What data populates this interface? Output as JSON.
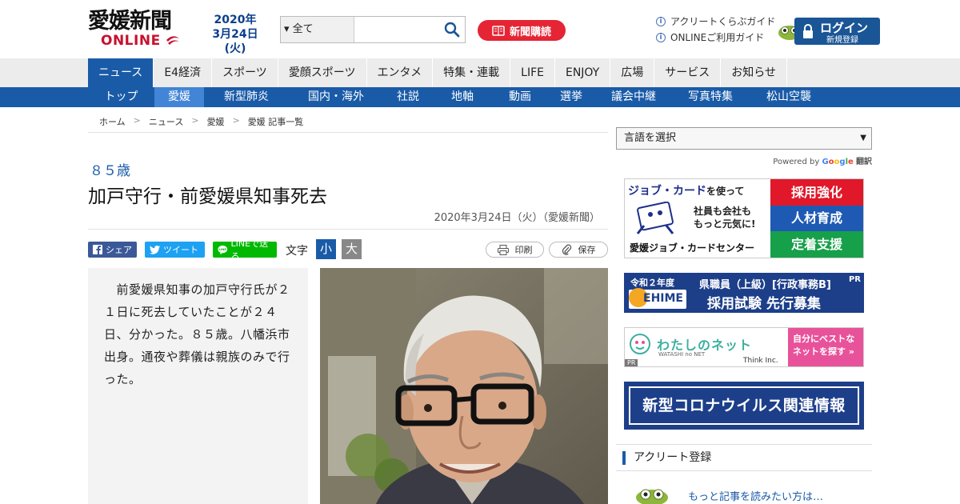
{
  "header": {
    "logo_line1": "愛媛新聞",
    "logo_line2": "ONLINE",
    "date_year": "2020年",
    "date_day": "3月24日(火)",
    "search_scope": "全て",
    "search_placeholder": "",
    "subscribe_label": "新聞購読",
    "links": [
      "アクリートくらぶガイド",
      "ONLINEご利用ガイド"
    ],
    "login_label": "ログイン",
    "register_label": "新規登録",
    "colors": {
      "brand_blue": "#1a5ba8",
      "brand_red": "#e52434"
    }
  },
  "main_nav": [
    "ニュース",
    "E4経済",
    "スポーツ",
    "愛顔スポーツ",
    "エンタメ",
    "特集・連載",
    "LIFE",
    "ENJOY",
    "広場",
    "サービス",
    "お知らせ"
  ],
  "sub_nav": [
    "トップ",
    "愛媛",
    "新型肺炎",
    "国内・海外",
    "社説",
    "地軸",
    "動画",
    "選挙",
    "議会中継",
    "写真特集",
    "松山空襲"
  ],
  "breadcrumb": [
    "ホーム",
    "ニュース",
    "愛媛",
    "愛媛 記事一覧"
  ],
  "breadcrumb_sep": ">",
  "article": {
    "kicker": "８５歳",
    "title": "加戸守行・前愛媛県知事死去",
    "byline": "2020年3月24日（火）（愛媛新聞）",
    "share": {
      "facebook": "シェア",
      "twitter": "ツイート",
      "line": "LINEで送る"
    },
    "font_size_label": "文字",
    "font_small": "小",
    "font_large": "大",
    "print_label": "印刷",
    "save_label": "保存",
    "body": "　前愛媛県知事の加戸守行氏が２１日に死去していたことが２４日、分かった。８５歳。八幡浜市出身。通夜や葬儀は親族のみで行った。"
  },
  "sidebar": {
    "language_select": "言語を選択",
    "powered_by": "Powered by",
    "google": [
      "G",
      "o",
      "o",
      "g",
      "l",
      "e"
    ],
    "translate": "翻訳",
    "ad_job": {
      "title_a": "ジョブ・カード",
      "title_b": "を使って",
      "sub1": "社員も会社も",
      "sub2": "もっと元気に!",
      "center": "愛媛ジョブ・カードセンター",
      "tags": [
        "採用強化",
        "人材育成",
        "定着支援"
      ]
    },
    "ad_pref": {
      "year": "令和２年度",
      "ehime": "EHIME",
      "line1": "県職員（上級）[行政事務B]",
      "line2": "採用試験 先行募集",
      "pr": "PR"
    },
    "ad_net": {
      "title": "わたしのネット",
      "sub": "WATASHI no NET",
      "company": "Think Inc.",
      "cta1": "自分にベストな",
      "cta2": "ネットを探す »",
      "pr": "PR"
    },
    "ad_corona": "新型コロナウイルス関連情報",
    "acrete_title": "アクリート登録",
    "more_text": "もっと記事を読みたい方は…"
  }
}
